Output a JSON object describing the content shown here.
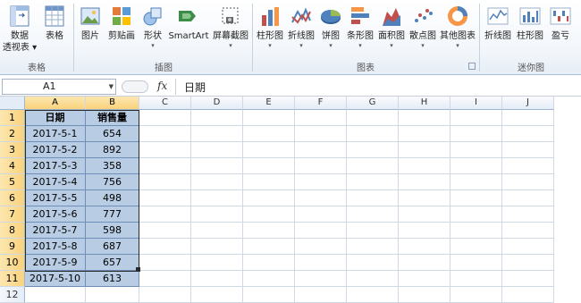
{
  "ribbon": {
    "buttons": [
      {
        "id": "pivot",
        "label": "数据",
        "label2": "透视表 ▾",
        "icon": "pivot-table-icon"
      },
      {
        "id": "table",
        "label": "表格",
        "icon": "table-icon"
      },
      {
        "id": "picture",
        "label": "图片",
        "icon": "picture-icon"
      },
      {
        "id": "clipart",
        "label": "剪贴画",
        "icon": "clip-art-icon"
      },
      {
        "id": "shapes",
        "label": "形状",
        "icon": "shapes-icon"
      },
      {
        "id": "smartart",
        "label": "SmartArt",
        "icon": "smartart-icon"
      },
      {
        "id": "screenshot",
        "label": "屏幕截图",
        "icon": "screenshot-icon"
      },
      {
        "id": "column",
        "label": "柱形图",
        "icon": "column-chart-icon"
      },
      {
        "id": "line",
        "label": "折线图",
        "icon": "line-chart-icon"
      },
      {
        "id": "pie",
        "label": "饼图",
        "icon": "pie-chart-icon"
      },
      {
        "id": "bar",
        "label": "条形图",
        "icon": "bar-chart-icon"
      },
      {
        "id": "area",
        "label": "面积图",
        "icon": "area-chart-icon"
      },
      {
        "id": "scatter",
        "label": "散点图",
        "icon": "scatter-chart-icon"
      },
      {
        "id": "other",
        "label": "其他图表",
        "icon": "other-charts-icon"
      },
      {
        "id": "spark_line",
        "label": "折线图",
        "icon": "sparkline-line-icon"
      },
      {
        "id": "spark_column",
        "label": "柱形图",
        "icon": "sparkline-column-icon"
      },
      {
        "id": "spark_winloss",
        "label": "盈亏",
        "icon": "sparkline-winloss-icon"
      }
    ],
    "groups": {
      "tables": "表格",
      "illustrations": "插图",
      "charts": "图表",
      "sparklines": "迷你图"
    }
  },
  "formula_bar": {
    "name_box": "A1",
    "fx": "fx",
    "value": "日期"
  },
  "columns": [
    "A",
    "B",
    "C",
    "D",
    "E",
    "F",
    "G",
    "H",
    "I",
    "J"
  ],
  "rows": [
    "1",
    "2",
    "3",
    "4",
    "5",
    "6",
    "7",
    "8",
    "9",
    "10",
    "11",
    "12"
  ],
  "table": {
    "headers": [
      "日期",
      "销售量"
    ],
    "data": [
      [
        "2017-5-1",
        "654"
      ],
      [
        "2017-5-2",
        "892"
      ],
      [
        "2017-5-3",
        "358"
      ],
      [
        "2017-5-4",
        "756"
      ],
      [
        "2017-5-5",
        "498"
      ],
      [
        "2017-5-6",
        "777"
      ],
      [
        "2017-5-7",
        "598"
      ],
      [
        "2017-5-8",
        "687"
      ],
      [
        "2017-5-9",
        "657"
      ],
      [
        "2017-5-10",
        "613"
      ]
    ]
  },
  "colors": {
    "selection": "#b8cce4",
    "header_highlight": "#f9d27c",
    "accent": "#2a5699"
  }
}
